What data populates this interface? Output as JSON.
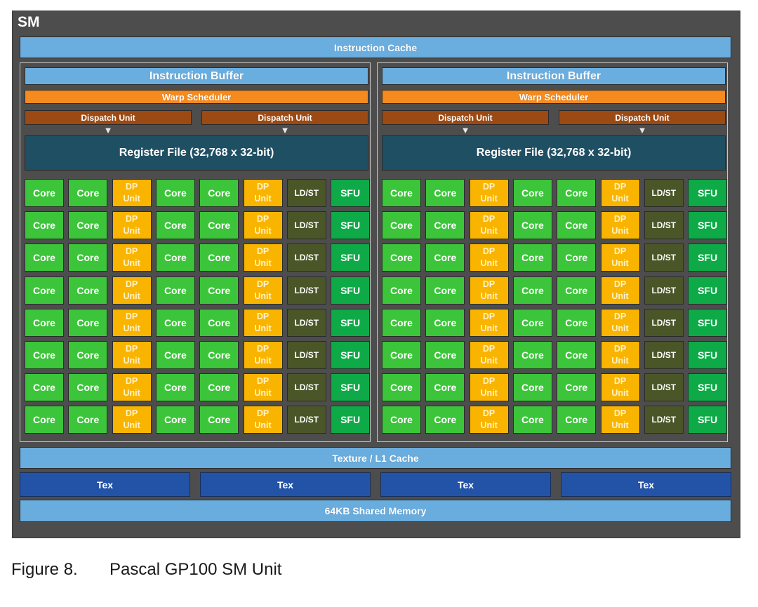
{
  "sm": {
    "title": "SM",
    "instruction_cache": "Instruction Cache",
    "processing_blocks": [
      {
        "instruction_buffer": "Instruction Buffer",
        "warp_scheduler": "Warp Scheduler",
        "dispatch_units": [
          "Dispatch Unit",
          "Dispatch Unit"
        ],
        "register_file": "Register File (32,768 x 32-bit)"
      },
      {
        "instruction_buffer": "Instruction Buffer",
        "warp_scheduler": "Warp Scheduler",
        "dispatch_units": [
          "Dispatch Unit",
          "Dispatch Unit"
        ],
        "register_file": "Register File (32,768 x 32-bit)"
      }
    ],
    "unit_row": [
      "Core",
      "Core",
      "DP Unit",
      "Core",
      "Core",
      "DP Unit",
      "LD/ST",
      "SFU"
    ],
    "unit_labels": {
      "core": "Core",
      "dp_line1": "DP",
      "dp_line2": "Unit",
      "ldst": "LD/ST",
      "sfu": "SFU"
    },
    "rows_per_block": 8,
    "texture_l1_cache": "Texture / L1 Cache",
    "tex_units": [
      "Tex",
      "Tex",
      "Tex",
      "Tex"
    ],
    "shared_memory": "64KB Shared Memory"
  },
  "caption": {
    "number": "Figure 8.",
    "text": "Pascal GP100 SM Unit"
  },
  "colors": {
    "sm_background": "#4d4d4d",
    "cache_blue": "#6aaee0",
    "warp_orange": "#f58a1f",
    "dispatch_brown": "#9b4a14",
    "register_teal": "#1f4f63",
    "core_green": "#3cc53a",
    "dp_yellow": "#f9b400",
    "ldst_olive": "#4b5628",
    "sfu_green": "#0eaa48",
    "tex_blue": "#2353a7"
  }
}
